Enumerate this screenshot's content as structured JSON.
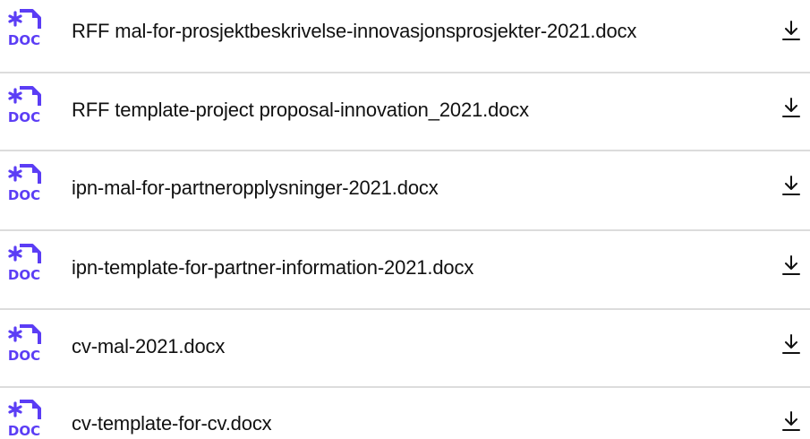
{
  "colors": {
    "icon_purple": "#5b3df5",
    "text": "#111111",
    "divider": "#dcdcdc"
  },
  "icons": {
    "file": "doc-file-icon",
    "download": "download-icon"
  },
  "files": [
    {
      "name": "RFF mal-for-prosjektbeskrivelse-innovasjonsprosjekter-2021.docx",
      "badge": "DOC"
    },
    {
      "name": "RFF template-project proposal-innovation_2021.docx",
      "badge": "DOC"
    },
    {
      "name": "ipn-mal-for-partneropplysninger-2021.docx",
      "badge": "DOC"
    },
    {
      "name": "ipn-template-for-partner-information-2021.docx",
      "badge": "DOC"
    },
    {
      "name": "cv-mal-2021.docx",
      "badge": "DOC"
    },
    {
      "name": "cv-template-for-cv.docx",
      "badge": "DOC"
    }
  ]
}
